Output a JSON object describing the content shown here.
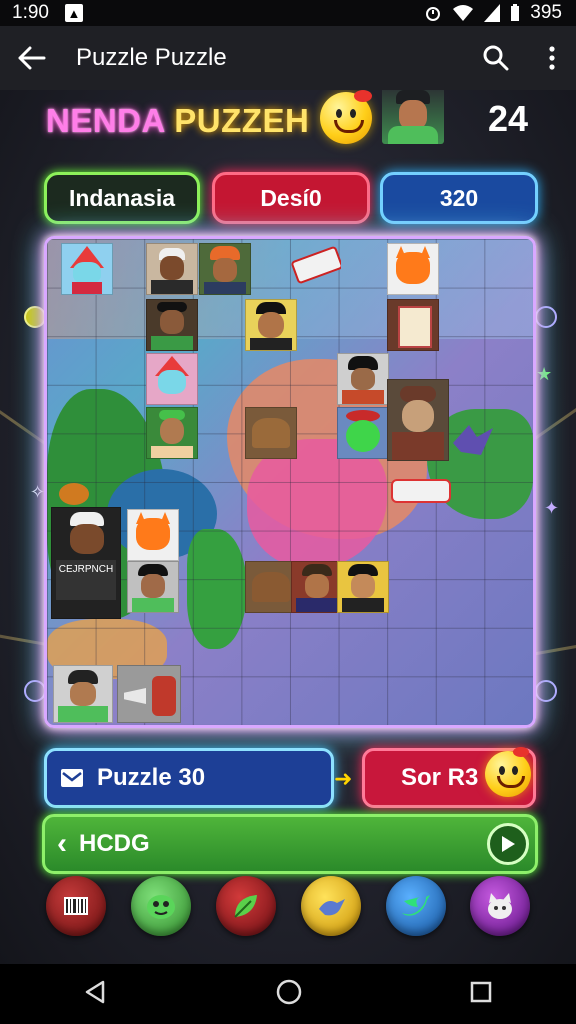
{
  "status_bar": {
    "time": "1:90",
    "battery_text": "395"
  },
  "app_bar": {
    "title": "Puzzle Puzzle"
  },
  "game": {
    "title_part1": "NENDA ",
    "title_part2": "PUZZEH",
    "score": "24",
    "pills": [
      {
        "label": "Indanasia",
        "color": "#8df15a"
      },
      {
        "label": "Desí0",
        "color": "#ff3a5e"
      },
      {
        "label": "320",
        "color": "#2fb4ff"
      }
    ],
    "puzzle_button": {
      "label": "Puzzle 30"
    },
    "sort_button": {
      "label": "Sor R3"
    },
    "hcdg_button": {
      "label": "HCDG"
    },
    "tile_text": "CEJRPNCH",
    "bottom_icons": [
      {
        "name": "barcode-icon",
        "color": "#8a1c1c"
      },
      {
        "name": "green-monster-icon",
        "color": "#3aa043"
      },
      {
        "name": "leaf-icon",
        "color": "#a8161d"
      },
      {
        "name": "bird-icon",
        "color": "#e0b400"
      },
      {
        "name": "twitter-icon",
        "color": "#1f7fd0"
      },
      {
        "name": "cat-icon",
        "color": "#8a22b0"
      }
    ]
  }
}
